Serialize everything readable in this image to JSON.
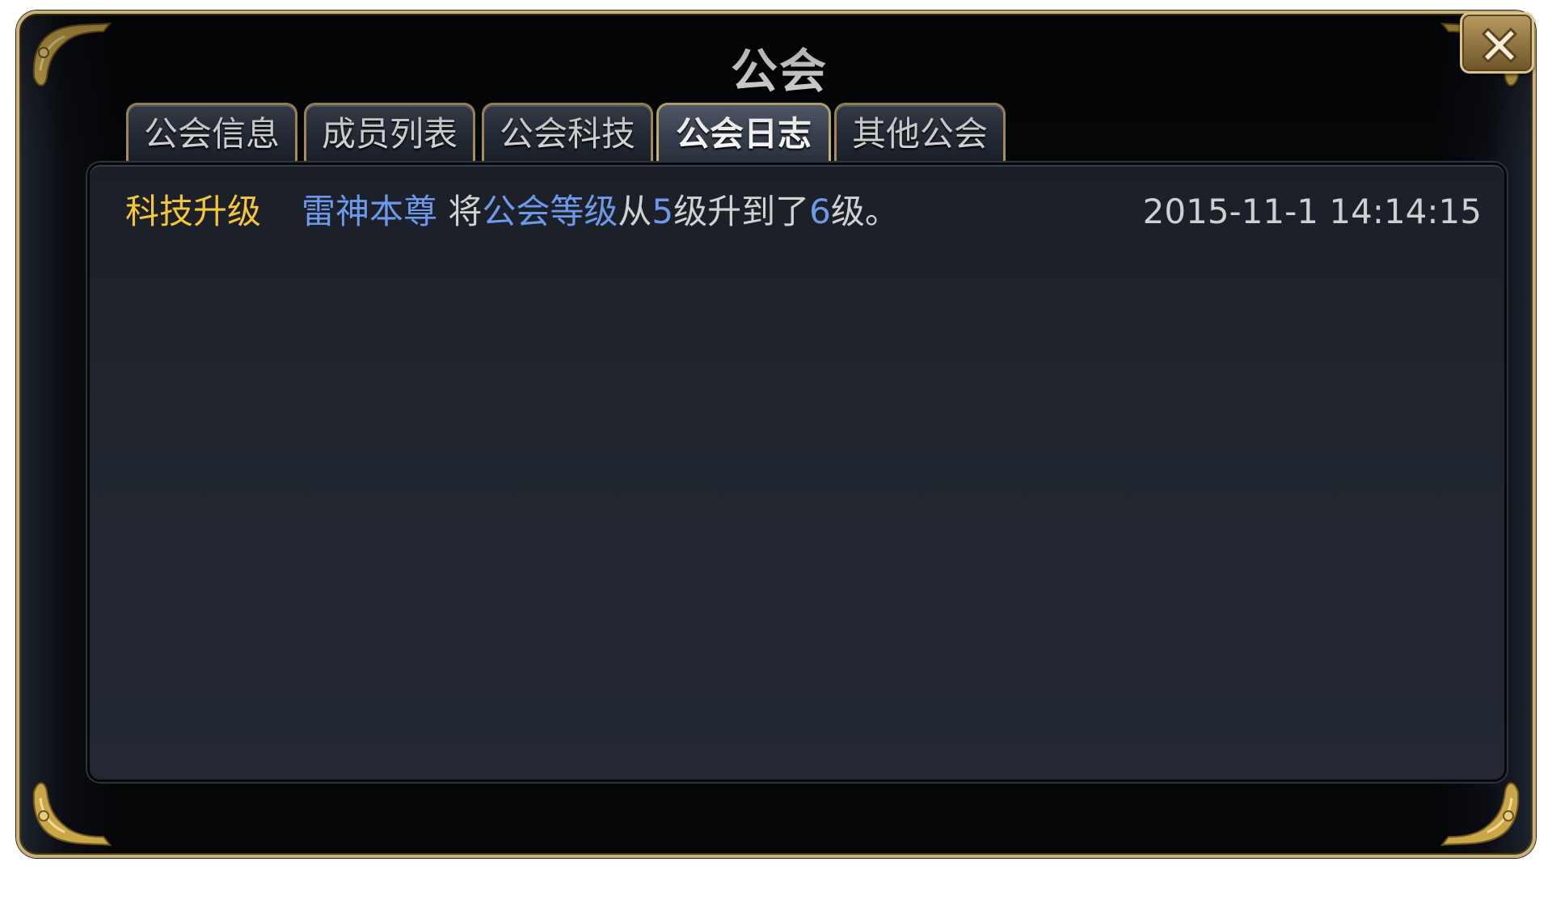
{
  "dialog": {
    "title": "公会",
    "close_icon": "close-x-icon"
  },
  "tabs": [
    {
      "label": "公会信息",
      "active": false
    },
    {
      "label": "成员列表",
      "active": false
    },
    {
      "label": "公会科技",
      "active": false
    },
    {
      "label": "公会日志",
      "active": true
    },
    {
      "label": "其他公会",
      "active": false
    }
  ],
  "log": {
    "entries": [
      {
        "type": "科技升级",
        "player": "雷神本尊",
        "text_1": " 将",
        "item": "公会等级",
        "text_2": "从",
        "from_level": "5",
        "text_3": "级升到了",
        "to_level": "6",
        "text_4": "级。",
        "time": "2015-11-1 14:14:15"
      }
    ]
  },
  "colors": {
    "frame_gold": "#c9b27a",
    "type_yellow": "#f5c53a",
    "highlight_blue": "#6e98ea",
    "text_gray": "#d2d2d2"
  }
}
